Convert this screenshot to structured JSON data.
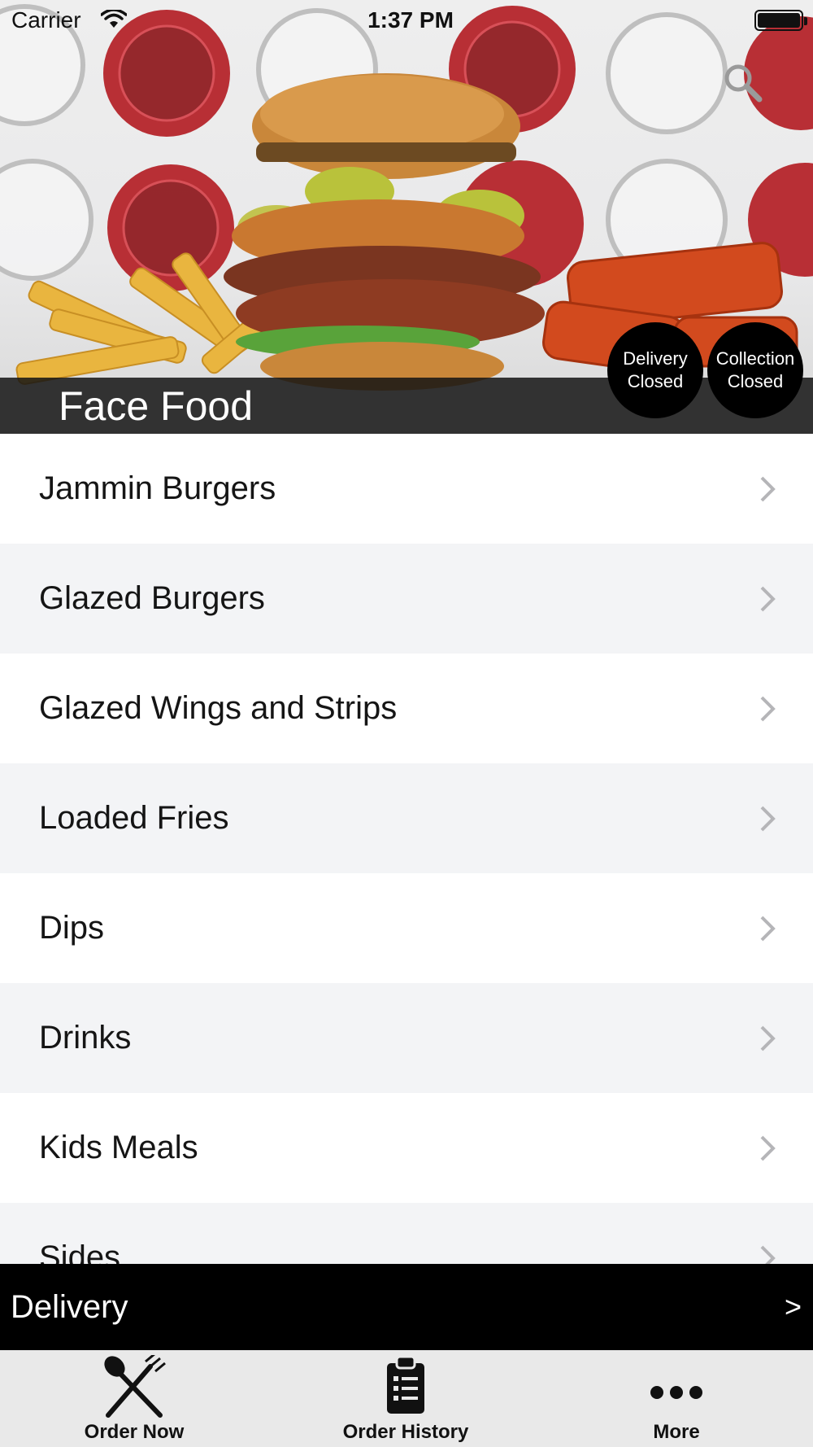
{
  "status_bar": {
    "carrier": "Carrier",
    "time": "1:37 PM"
  },
  "hero": {
    "store_name": "Face Food",
    "badges": [
      {
        "line1": "Delivery",
        "line2": "Closed"
      },
      {
        "line1": "Collection",
        "line2": "Closed"
      }
    ],
    "search_icon": "search-icon"
  },
  "menu": {
    "items": [
      {
        "label": "Jammin Burgers"
      },
      {
        "label": "Glazed Burgers"
      },
      {
        "label": "Glazed Wings and Strips"
      },
      {
        "label": "Loaded Fries"
      },
      {
        "label": "Dips"
      },
      {
        "label": "Drinks"
      },
      {
        "label": "Kids Meals"
      },
      {
        "label": "Sides"
      }
    ]
  },
  "delivery_bar": {
    "label": "Delivery",
    "arrow": ">"
  },
  "tab_bar": {
    "tabs": [
      {
        "label": "Order Now",
        "icon": "fork-knife-icon"
      },
      {
        "label": "Order History",
        "icon": "clipboard-list-icon"
      },
      {
        "label": "More",
        "icon": "more-dots-icon"
      }
    ]
  }
}
